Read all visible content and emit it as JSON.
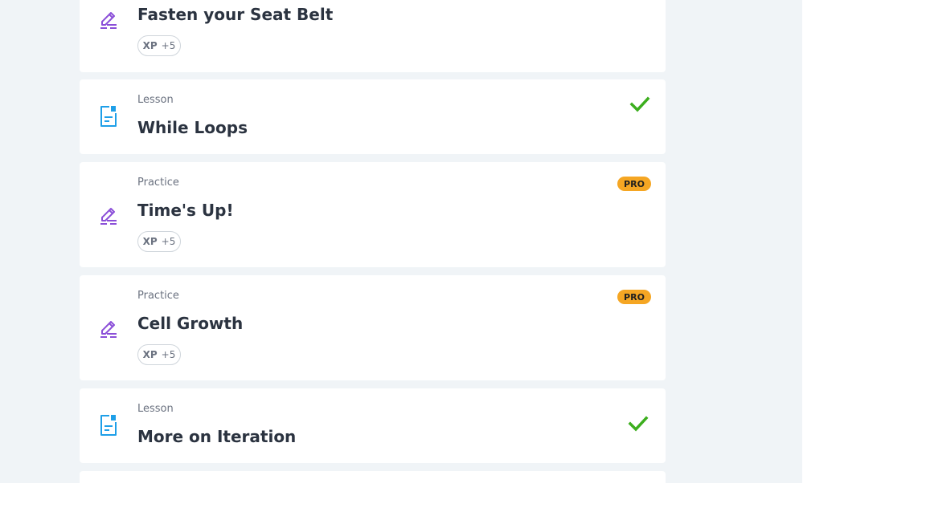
{
  "items": [
    {
      "kind": "",
      "icon": "pencil-icon",
      "title": "Fasten your Seat Belt",
      "xp_label": "XP",
      "xp_value": "+5"
    },
    {
      "kind": "Lesson",
      "icon": "lesson-doc-icon",
      "title": "While Loops",
      "completed": true
    },
    {
      "kind": "Practice",
      "icon": "pencil-icon",
      "title": "Time's Up!",
      "xp_label": "XP",
      "xp_value": "+5",
      "badge": "PRO"
    },
    {
      "kind": "Practice",
      "icon": "pencil-icon",
      "title": "Cell Growth",
      "xp_label": "XP",
      "xp_value": "+5",
      "badge": "PRO"
    },
    {
      "kind": "Lesson",
      "icon": "lesson-doc-icon",
      "title": "More on Iteration",
      "completed": true
    }
  ],
  "colors": {
    "practice_icon": "#8b4fd8",
    "lesson_icon": "#1e9fe8",
    "check": "#3cae1e",
    "pro_badge": "#f5a623",
    "page_bg": "#f0f4f7"
  }
}
